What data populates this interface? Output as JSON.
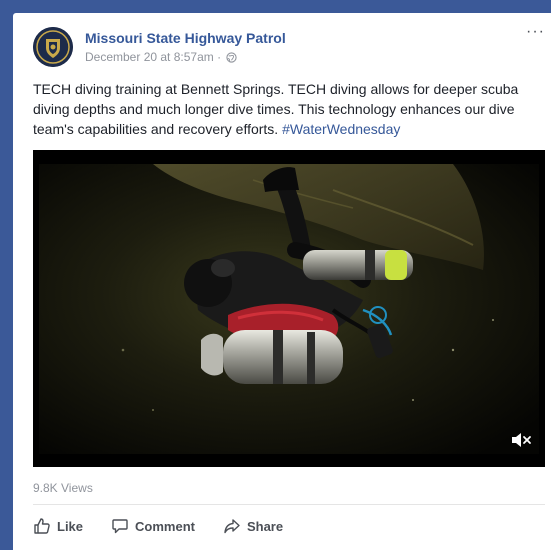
{
  "post": {
    "author": "Missouri State Highway Patrol",
    "timestamp": "December 20 at 8:57am",
    "separator": "·",
    "privacy_icon": "globe-icon",
    "more_label": "···",
    "text": "TECH diving training at Bennett Springs. TECH diving allows for deeper scuba diving depths and much longer dive times. This technology enhances our dive team's capabilities and recovery efforts.",
    "hashtag": "#WaterWednesday",
    "video": {
      "muted": true,
      "mute_icon": "muted-speaker-icon"
    },
    "views": "9.8K Views"
  },
  "actions": {
    "like_label": "Like",
    "comment_label": "Comment",
    "share_label": "Share"
  },
  "colors": {
    "page_background": "#3b5998",
    "link": "#365899",
    "action_text": "#4b4f56",
    "meta_text": "#90949c"
  }
}
